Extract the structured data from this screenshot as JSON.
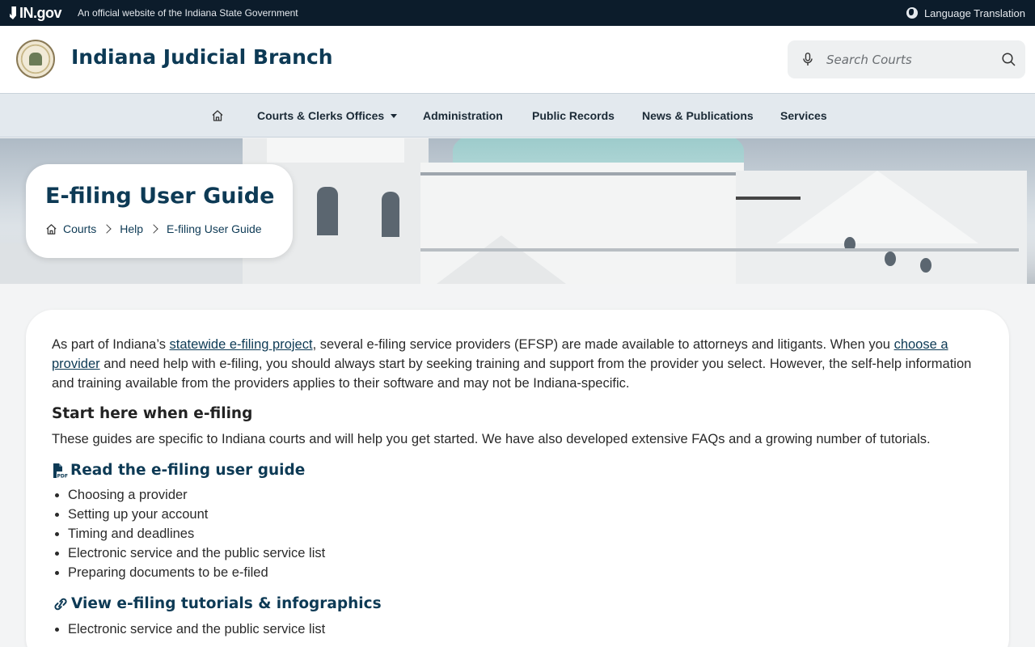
{
  "topbar": {
    "brand": "IN.gov",
    "official_text": "An official website of the Indiana State Government",
    "language": "Language Translation"
  },
  "header": {
    "site_title": "Indiana Judicial Branch",
    "search_placeholder": "Search Courts"
  },
  "nav": {
    "items": [
      {
        "label": "Courts & Clerks Offices",
        "dropdown": true
      },
      {
        "label": "Administration"
      },
      {
        "label": "Public Records"
      },
      {
        "label": "News & Publications"
      },
      {
        "label": "Services"
      }
    ]
  },
  "hero": {
    "title": "E-filing User Guide",
    "breadcrumb": [
      "Courts",
      "Help",
      "E-filing User Guide"
    ]
  },
  "content": {
    "intro_1": "As part of Indiana’s ",
    "intro_link_1": "statewide e-filing project",
    "intro_2": ", several e-filing service providers (EFSP) are made available to attorneys and litigants. When you ",
    "intro_link_2": "choose a provider",
    "intro_3": " and need help with e-filing, you should always start by seeking training and support from the provider you select. However, the self-help information and training available from the providers applies to their software and may not be Indiana-specific.",
    "start_heading": "Start here when e-filing",
    "start_text": "These guides are specific to Indiana courts and will help you get started. We have also developed extensive FAQs and a growing number of tutorials.",
    "guide_link": "Read the e-filing user guide",
    "guide_items": [
      "Choosing a provider",
      "Setting up your account",
      "Timing and deadlines",
      "Electronic service and the public service list",
      "Preparing documents to be e-filed"
    ],
    "tutorials_link": "View e-filing tutorials & infographics",
    "tutorial_items": [
      "Electronic service and the public service list"
    ]
  },
  "colors": {
    "topbar_bg": "#0c1c2b",
    "brand_blue": "#0d3a55",
    "nav_bg": "#e3e9ee",
    "page_bg": "#f3f4f5"
  }
}
